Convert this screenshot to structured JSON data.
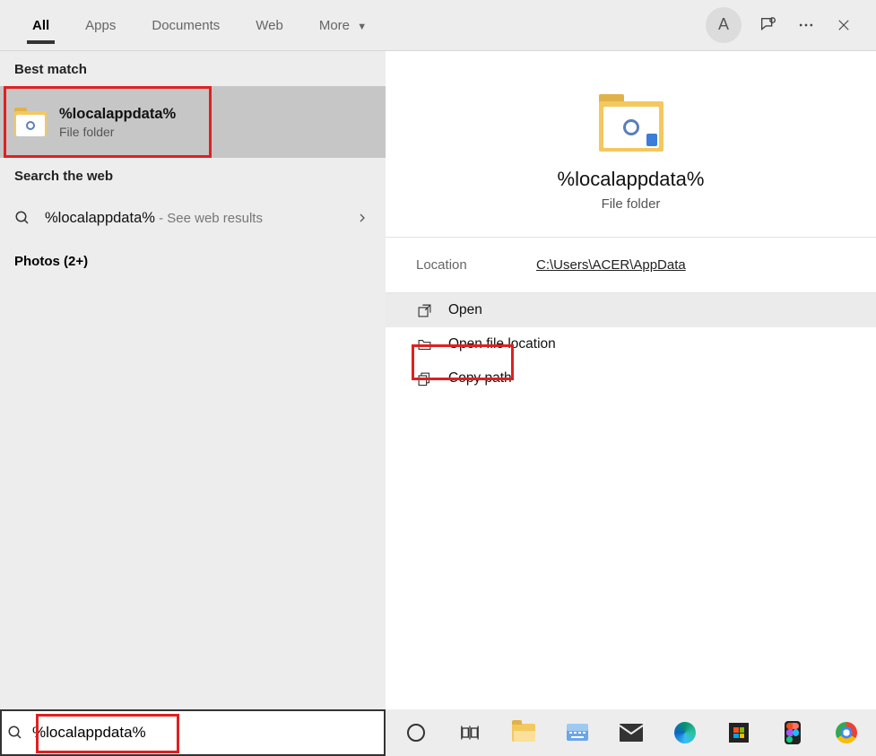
{
  "header": {
    "tabs": [
      {
        "label": "All",
        "active": true
      },
      {
        "label": "Apps"
      },
      {
        "label": "Documents"
      },
      {
        "label": "Web"
      },
      {
        "label": "More"
      }
    ],
    "avatar_letter": "A"
  },
  "left": {
    "best_match_label": "Best match",
    "best_match": {
      "title": "%localappdata%",
      "subtitle": "File folder"
    },
    "web_label": "Search the web",
    "web": {
      "title": "%localappdata%",
      "suffix": " - See web results"
    },
    "photos_label": "Photos (2+)"
  },
  "right": {
    "title": "%localappdata%",
    "subtitle": "File folder",
    "location_label": "Location",
    "location_value": "C:\\Users\\ACER\\AppData",
    "actions": [
      {
        "id": "open",
        "label": "Open",
        "selected": true
      },
      {
        "id": "open-location",
        "label": "Open file location"
      },
      {
        "id": "copy-path",
        "label": "Copy path"
      }
    ]
  },
  "search": {
    "value": "%localappdata%"
  }
}
